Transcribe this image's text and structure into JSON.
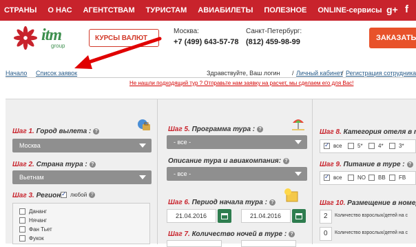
{
  "nav": {
    "items": [
      "СТРАНЫ",
      "О НАС",
      "АГЕНТСТВАМ",
      "ТУРИСТАМ",
      "АВИАБИЛЕТЫ",
      "ПОЛЕЗНОЕ",
      "ONLINE-сервисы"
    ],
    "gplus": "g+",
    "fb": "f"
  },
  "header": {
    "logo_text": "itm",
    "logo_sub": "group",
    "courses_label": "КУРСЫ ВАЛЮТ",
    "moscow_city": "Москва:",
    "moscow_phone": "+7 (499) 643-57-78",
    "spb_city": "Санкт-Петербург:",
    "spb_phone": "(812) 459-98-99",
    "order_label": "ЗАКАЗАТЬ"
  },
  "breadcrumbs": {
    "home": "Начало",
    "requests": "Список заявок",
    "greeting": "Здравствуйте, Ваш логин",
    "cabinet": "Личный кабинет",
    "register": "Регистрация сотрудника",
    "sep1": "/",
    "sep2": "/"
  },
  "notice": "Не нашли подходящий тур ? Отправьте нам заявку на расчет, мы сделаем его для Вас!",
  "form": {
    "step1": {
      "num": "Шаг 1.",
      "label": "Город вылета :",
      "value": "Москва"
    },
    "step2": {
      "num": "Шаг 2.",
      "label": "Страна тура :",
      "value": "Вьетнам"
    },
    "step3": {
      "num": "Шаг 3.",
      "label": "Регион :",
      "any": "любой",
      "regions": [
        "Дананг",
        "Нячанг",
        "Фан Тьет",
        "Фукок"
      ]
    },
    "step5": {
      "num": "Шаг 5.",
      "label": "Программа тура :",
      "value": "- все -"
    },
    "desc": {
      "label": "Описание тура и авиакомпания:",
      "value": "- все -"
    },
    "step6": {
      "num": "Шаг 6.",
      "label": "Период начала тура :",
      "from": "21.04.2016",
      "to": "21.04.2016"
    },
    "step7": {
      "num": "Шаг 7.",
      "label": "Количество ночей в туре :"
    },
    "step8": {
      "num": "Шаг 8.",
      "label": "Категория отеля в т",
      "options": [
        "все",
        "5*",
        "4*",
        "3*"
      ]
    },
    "step9": {
      "num": "Шаг 9.",
      "label": "Питание в туре :",
      "options": [
        "все",
        "NO",
        "BB",
        "FB"
      ]
    },
    "step10": {
      "num": "Шаг 10.",
      "label": "Размещение в номере",
      "adults_value": "2",
      "adults_label": "Количество взрослых/детей на с",
      "kids_value": "0",
      "kids_label": "Количество взрослых/детей на с"
    }
  },
  "question": "?"
}
